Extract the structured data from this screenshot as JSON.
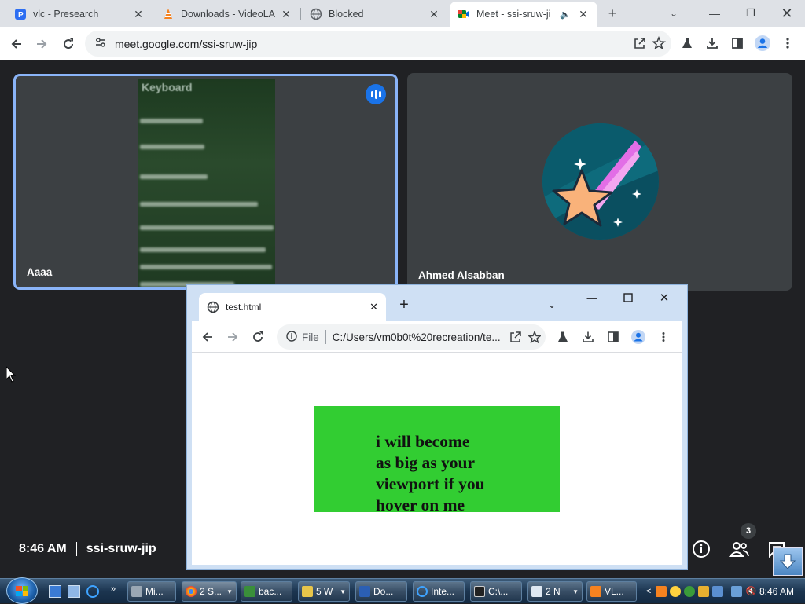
{
  "browser": {
    "tabs": [
      {
        "title": "vlc - Presearch",
        "icon": "presearch-icon"
      },
      {
        "title": "Downloads - VideoLA",
        "icon": "vlc-cone-icon"
      },
      {
        "title": "Blocked",
        "icon": "globe-icon"
      },
      {
        "title": "Meet - ssi-sruw-ji",
        "icon": "meet-icon",
        "active": true
      }
    ],
    "url": "meet.google.com/ssi-sruw-jip"
  },
  "meet": {
    "tiles": [
      {
        "name": "Aaaa",
        "speaking": true
      },
      {
        "name": "Ahmed Alsabban"
      }
    ],
    "camera_text_lines": [
      "Keyboard",
      "has voted no.",
      "has voted no.",
      "has voted yes.",
      "e Contraction has asked to..",
      "e Contraction - a..",
      "the vote to reset the ..",
      "he Contraction - d.."
    ],
    "time": "8:46 AM",
    "meeting_code": "ssi-sruw-jip",
    "participants_count": "3"
  },
  "test_window": {
    "tab_title": "test.html",
    "file_label": "File",
    "url": "C:/Users/vm0b0t%20recreation/te...",
    "box_lines": [
      "i will become",
      "as big as your",
      "viewport if you",
      "hover on me"
    ],
    "box_color": "#32cd32"
  },
  "taskbar": {
    "items": [
      {
        "label": "Mi...",
        "icon": "gear-icon"
      },
      {
        "label": "2 S...",
        "icon": "chrome-icon",
        "group": true
      },
      {
        "label": "bac...",
        "icon": "vim-icon"
      },
      {
        "label": "5 W",
        "icon": "folder-icon",
        "group": true
      },
      {
        "label": "Do...",
        "icon": "word-icon"
      },
      {
        "label": "Inte...",
        "icon": "ie-icon"
      },
      {
        "label": "C:\\...",
        "icon": "7zip-icon"
      },
      {
        "label": "2 N",
        "icon": "notepad-icon",
        "group": true
      },
      {
        "label": "VL...",
        "icon": "vlc-cone-icon"
      }
    ],
    "clock": "8:46 AM"
  }
}
